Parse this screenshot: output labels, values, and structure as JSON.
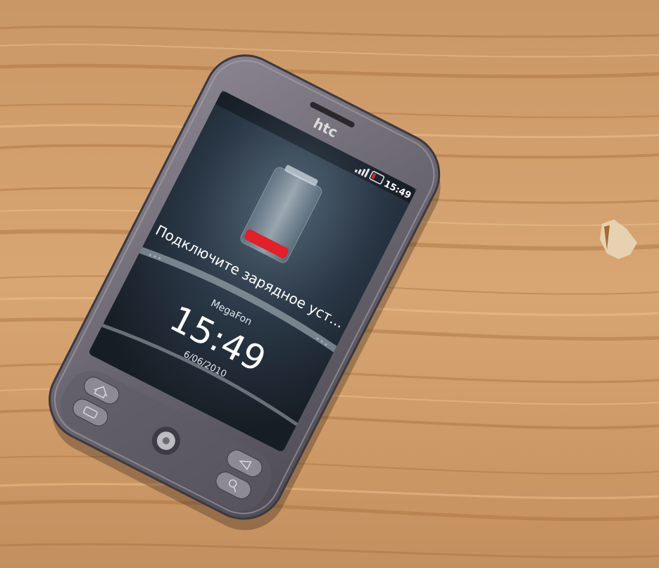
{
  "phone": {
    "brand": "htc",
    "status_time": "15:49",
    "alert_text": "Подключите зарядное уст...",
    "carrier": "MegaFon",
    "clock": "15:49",
    "date": "6/06/2010"
  },
  "colors": {
    "wood_light": "#d9a772",
    "wood_dark": "#b87e4c",
    "phone_body": "#6e6a70",
    "screen": "#1c2630",
    "battery_red": "#e0202a"
  },
  "icons": {
    "battery": "battery-empty-icon",
    "signal": "signal-icon",
    "home": "home-icon",
    "menu": "menu-icon",
    "back": "back-icon",
    "search": "search-icon",
    "trackpad": "optical-trackpad"
  }
}
